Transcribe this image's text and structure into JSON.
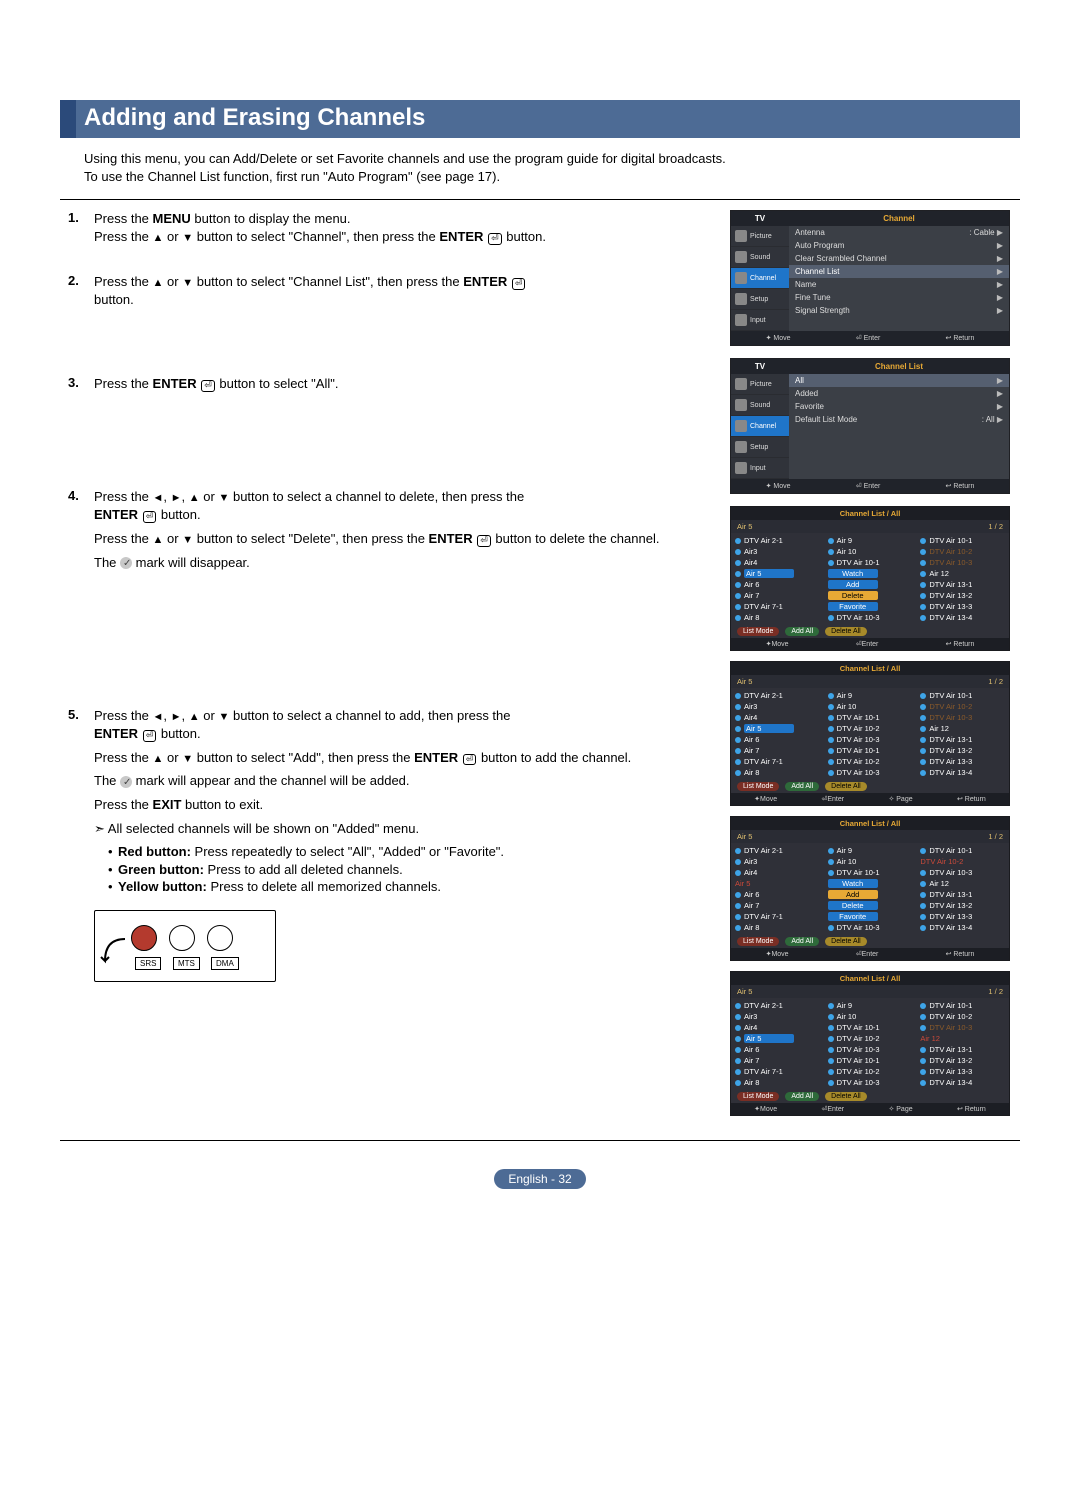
{
  "title": "Adding and Erasing Channels",
  "intro_line1": "Using this menu, you can Add/Delete or set Favorite channels and use the program guide for digital broadcasts.",
  "intro_line2": "To use the Channel List function, first run \"Auto Program\" (see page 17).",
  "steps": {
    "s1": {
      "num": "1.",
      "p1a": "Press the ",
      "p1b": " button to display the menu.",
      "menu": "MENU",
      "p2a": "Press the ",
      "p2b": " or ",
      "p2c": " button to select \"Channel\", then press the ",
      "p2d": " button.",
      "enter": "ENTER"
    },
    "s2": {
      "num": "2.",
      "p1a": "Press the ",
      "p1b": " or ",
      "p1c": " button to select \"Channel List\", then press the ",
      "p1d": " button.",
      "enter": "ENTER"
    },
    "s3": {
      "num": "3.",
      "p1a": "Press the ",
      "p1b": " button to select \"All\".",
      "enter": "ENTER"
    },
    "s4": {
      "num": "4.",
      "p1a": "Press the  ",
      "p1b": " or ",
      "p1c": " button to select a channel to delete, then press the ",
      "p1d": " button.",
      "enter": "ENTER",
      "p2a": "Press the ",
      "p2b": " or ",
      "p2c": " button to select \"Delete\", then press the ",
      "p2d": " button to delete the channel.",
      "p3": "The        mark will disappear.",
      "p3_pre": "The ",
      "p3_post": " mark will disappear."
    },
    "s5": {
      "num": "5.",
      "p1a": "Press the  ",
      "p1b": " or ",
      "p1c": " button to select a channel to add, then press the ",
      "p1d": " button.",
      "enter": "ENTER",
      "p2a": "Press the ",
      "p2b": " or ",
      "p2c": " button to select \"Add\", then press the ",
      "p2d": " button to add the channel.",
      "p3_pre": "The ",
      "p3_post": " mark will appear and the channel will be added.",
      "p4a": "Press the ",
      "exit": "EXIT",
      "p4b": " button to exit.",
      "note": "All selected channels will be shown on \"Added\" menu.",
      "b1a": "Red button:",
      "b1b": " Press repeatedly to select \"All\", \"Added\" or \"Favorite\".",
      "b2a": "Green button:",
      "b2b": " Press to add all deleted channels.",
      "b3a": "Yellow button:",
      "b3b": " Press to delete all memorized channels."
    }
  },
  "osd1": {
    "side_hdr": "TV",
    "main_hdr": "Channel",
    "side": [
      "Picture",
      "Sound",
      "Channel",
      "Setup",
      "Input"
    ],
    "rows": [
      {
        "l": "Antenna",
        "r": ": Cable",
        "a": "▶"
      },
      {
        "l": "Auto Program",
        "r": "",
        "a": "▶"
      },
      {
        "l": "Clear Scrambled Channel",
        "r": "",
        "a": "▶"
      },
      {
        "l": "Channel List",
        "r": "",
        "a": "▶",
        "hl": true
      },
      {
        "l": "Name",
        "r": "",
        "a": "▶"
      },
      {
        "l": "Fine Tune",
        "r": "",
        "a": "▶"
      },
      {
        "l": "Signal Strength",
        "r": "",
        "a": "▶"
      }
    ],
    "foot": [
      "✦ Move",
      "⏎ Enter",
      "↩ Return"
    ]
  },
  "osd2": {
    "side_hdr": "TV",
    "main_hdr": "Channel List",
    "side": [
      "Picture",
      "Sound",
      "Channel",
      "Setup",
      "Input"
    ],
    "rows": [
      {
        "l": "All",
        "r": "",
        "a": "▶",
        "hl": true
      },
      {
        "l": "Added",
        "r": "",
        "a": "▶"
      },
      {
        "l": "Favorite",
        "r": "",
        "a": "▶"
      },
      {
        "l": "Default List Mode",
        "r": ": All",
        "a": "▶"
      }
    ],
    "foot": [
      "✦ Move",
      "⏎ Enter",
      "↩ Return"
    ]
  },
  "clist_common": {
    "hdr": "Channel List / All",
    "sub_left": "Air 5",
    "sub_right": "1 / 2",
    "col1": [
      "DTV Air 2-1",
      "Air3",
      "Air4",
      "Air 5",
      "Air 6",
      "Air 7",
      "DTV Air 7-1",
      "Air 8"
    ],
    "col2": [
      "Air 9",
      "Air 10",
      "DTV Air 10-1",
      "DTV Air 10-2",
      "DTV Air 10-3",
      "DTV Air 10-1",
      "DTV Air 10-2",
      "DTV Air 10-3"
    ],
    "col3": [
      "DTV Air 10-1",
      "DTV Air 10-2",
      "DTV Air 10-3",
      "Air 12",
      "DTV Air 13-1",
      "DTV Air 13-2",
      "DTV Air 13-3",
      "DTV Air 13-4"
    ],
    "btns": {
      "red": "List Mode",
      "green": "Add All",
      "yellow": "Delete All"
    },
    "foot_a": [
      "✦Move",
      "⏎Enter",
      "↩ Return"
    ],
    "foot_b": [
      "✦Move",
      "⏎Enter",
      "✧ Page",
      "↩ Return"
    ]
  },
  "clist1_menu": [
    "Watch",
    "Add",
    "Delete",
    "Favorite"
  ],
  "clist3_menu": [
    "Watch",
    "Add",
    "Delete",
    "Favorite"
  ],
  "remote_labels": [
    "SRS",
    "MTS",
    "DMA"
  ],
  "page_footer": "English - 32"
}
